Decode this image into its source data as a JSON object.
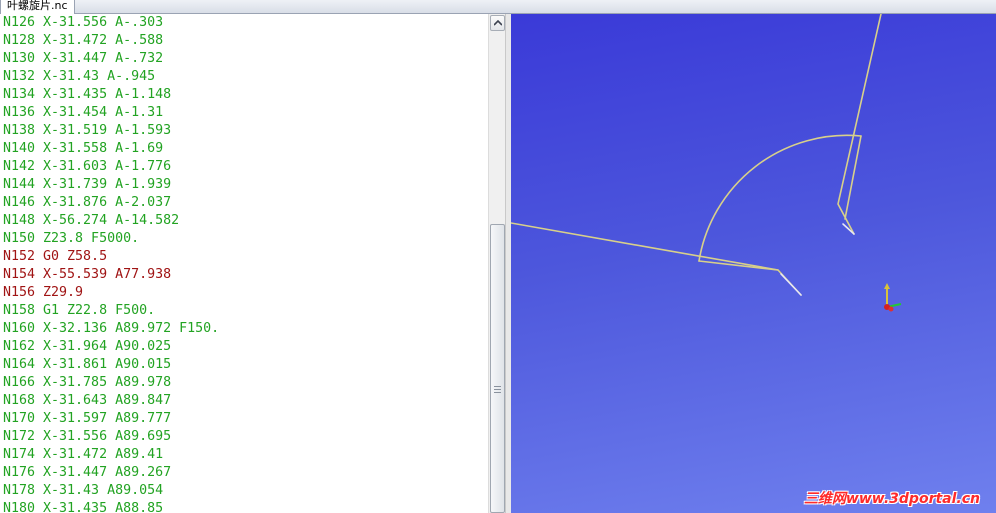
{
  "tab": {
    "title": "叶螺旋片.nc"
  },
  "code": {
    "normal_color": "#22a322",
    "rapid_color": "#a01414",
    "lines": [
      {
        "text": "N126 X-31.556 A-.303",
        "kind": "normal"
      },
      {
        "text": "N128 X-31.472 A-.588",
        "kind": "normal"
      },
      {
        "text": "N130 X-31.447 A-.732",
        "kind": "normal"
      },
      {
        "text": "N132 X-31.43 A-.945",
        "kind": "normal"
      },
      {
        "text": "N134 X-31.435 A-1.148",
        "kind": "normal"
      },
      {
        "text": "N136 X-31.454 A-1.31",
        "kind": "normal"
      },
      {
        "text": "N138 X-31.519 A-1.593",
        "kind": "normal"
      },
      {
        "text": "N140 X-31.558 A-1.69",
        "kind": "normal"
      },
      {
        "text": "N142 X-31.603 A-1.776",
        "kind": "normal"
      },
      {
        "text": "N144 X-31.739 A-1.939",
        "kind": "normal"
      },
      {
        "text": "N146 X-31.876 A-2.037",
        "kind": "normal"
      },
      {
        "text": "N148 X-56.274 A-14.582",
        "kind": "normal"
      },
      {
        "text": "N150 Z23.8 F5000.",
        "kind": "normal"
      },
      {
        "text": "N152 G0 Z58.5",
        "kind": "rapid"
      },
      {
        "text": "N154 X-55.539 A77.938",
        "kind": "rapid"
      },
      {
        "text": "N156 Z29.9",
        "kind": "rapid"
      },
      {
        "text": "N158 G1 Z22.8 F500.",
        "kind": "normal"
      },
      {
        "text": "N160 X-32.136 A89.972 F150.",
        "kind": "normal"
      },
      {
        "text": "N162 X-31.964 A90.025",
        "kind": "normal"
      },
      {
        "text": "N164 X-31.861 A90.015",
        "kind": "normal"
      },
      {
        "text": "N166 X-31.785 A89.978",
        "kind": "normal"
      },
      {
        "text": "N168 X-31.643 A89.847",
        "kind": "normal"
      },
      {
        "text": "N170 X-31.597 A89.777",
        "kind": "normal"
      },
      {
        "text": "N172 X-31.556 A89.695",
        "kind": "normal"
      },
      {
        "text": "N174 X-31.472 A89.41",
        "kind": "normal"
      },
      {
        "text": "N176 X-31.447 A89.267",
        "kind": "normal"
      },
      {
        "text": "N178 X-31.43 A89.054",
        "kind": "normal"
      },
      {
        "text": "N180 X-31.435 A88.85",
        "kind": "normal"
      }
    ]
  },
  "scrollbar": {
    "up_icon": "arrow-up-icon",
    "grip_icon": "grip-icon"
  },
  "viewport": {
    "toolpath_color": "#d8d08a",
    "axis_icon": "axis-triad-icon",
    "watermark": "三维网www.3dportal.cn"
  }
}
